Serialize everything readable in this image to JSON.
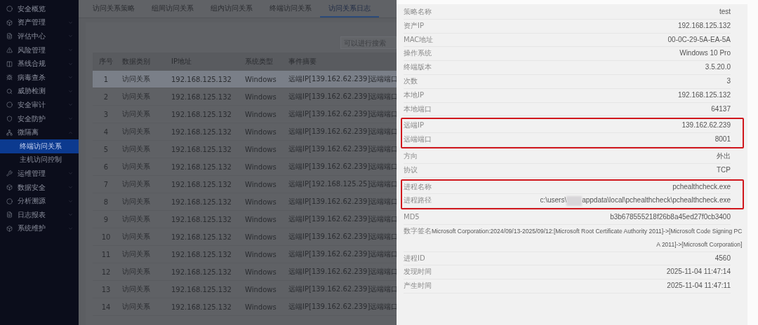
{
  "sidebar": {
    "items": [
      {
        "label": "安全概览",
        "selected": false
      },
      {
        "label": "资产管理",
        "selected": false
      },
      {
        "label": "评估中心",
        "selected": false
      },
      {
        "label": "风险管理",
        "selected": false
      },
      {
        "label": "基线合规",
        "selected": false
      },
      {
        "label": "病毒查杀",
        "selected": false
      },
      {
        "label": "威胁检测",
        "selected": false
      },
      {
        "label": "安全审计",
        "selected": false
      },
      {
        "label": "安全防护",
        "selected": false
      },
      {
        "label": "微隔离",
        "selected": false,
        "children": [
          {
            "label": "终端访问关系",
            "selected": true
          },
          {
            "label": "主机访问控制",
            "selected": false
          }
        ]
      },
      {
        "label": "运维管理",
        "selected": false
      },
      {
        "label": "数据安全",
        "selected": false
      },
      {
        "label": "分析溯源",
        "selected": false
      },
      {
        "label": "日志报表",
        "selected": false
      },
      {
        "label": "系统维护",
        "selected": false
      }
    ]
  },
  "tabs": [
    {
      "label": "访问关系策略",
      "selected": false
    },
    {
      "label": "组间访问关系",
      "selected": false
    },
    {
      "label": "组内访问关系",
      "selected": false
    },
    {
      "label": "终端访问关系",
      "selected": false
    },
    {
      "label": "访问关系日志",
      "selected": true
    }
  ],
  "search": {
    "placeholder": "可以进行搜索"
  },
  "table": {
    "columns": [
      "序号",
      "数据类别",
      "IP地址",
      "系统类型",
      "事件摘要"
    ],
    "rows": [
      {
        "cells": [
          "1",
          "访问关系",
          "192.168.125.132",
          "Windows",
          "远端IP[139.162.62.239]远端端口"
        ],
        "selected": true
      },
      {
        "cells": [
          "2",
          "访问关系",
          "192.168.125.132",
          "Windows",
          "远端IP[139.162.62.239]远端端口"
        ],
        "selected": false
      },
      {
        "cells": [
          "3",
          "访问关系",
          "192.168.125.132",
          "Windows",
          "远端IP[139.162.62.239]远端端口"
        ],
        "selected": false
      },
      {
        "cells": [
          "4",
          "访问关系",
          "192.168.125.132",
          "Windows",
          "远端IP[139.162.62.239]远端端口"
        ],
        "selected": false
      },
      {
        "cells": [
          "5",
          "访问关系",
          "192.168.125.132",
          "Windows",
          "远端IP[139.162.62.239]远端端口"
        ],
        "selected": false
      },
      {
        "cells": [
          "6",
          "访问关系",
          "192.168.125.132",
          "Windows",
          "远端IP[139.162.62.239]远端端口"
        ],
        "selected": false
      },
      {
        "cells": [
          "7",
          "访问关系",
          "192.168.125.132",
          "Windows",
          "远端IP[192.168.125.25]远端端口"
        ],
        "selected": false
      },
      {
        "cells": [
          "8",
          "访问关系",
          "192.168.125.132",
          "Windows",
          "远端IP[139.162.62.239]远端端口"
        ],
        "selected": false
      },
      {
        "cells": [
          "9",
          "访问关系",
          "192.168.125.132",
          "Windows",
          "远端IP[139.162.62.239]远端端口"
        ],
        "selected": false
      },
      {
        "cells": [
          "10",
          "访问关系",
          "192.168.125.132",
          "Windows",
          "远端IP[139.162.62.239]远端端口"
        ],
        "selected": false
      },
      {
        "cells": [
          "11",
          "访问关系",
          "192.168.125.132",
          "Windows",
          "远端IP[139.162.62.239]远端端口"
        ],
        "selected": false
      },
      {
        "cells": [
          "12",
          "访问关系",
          "192.168.125.132",
          "Windows",
          "远端IP[139.162.62.239]远端端口"
        ],
        "selected": false
      },
      {
        "cells": [
          "13",
          "访问关系",
          "192.168.125.132",
          "Windows",
          "远端IP[139.162.62.239]远端端口"
        ],
        "selected": false
      },
      {
        "cells": [
          "14",
          "访问关系",
          "192.168.125.132",
          "Windows",
          "远端IP[139.162.62.239]远端端口"
        ],
        "selected": false
      }
    ]
  },
  "details": {
    "groups": [
      {
        "highlighted": false,
        "fields": [
          {
            "label": "策略名称",
            "value": [
              "test"
            ]
          },
          {
            "label": "资产IP",
            "value": [
              "192.168.125.132"
            ]
          },
          {
            "label": "MAC地址",
            "value": [
              "00-0C-29-5A-EA-5A"
            ]
          },
          {
            "label": "操作系统",
            "value": [
              "Windows 10 Pro"
            ]
          },
          {
            "label": "终端版本",
            "value": [
              "3.5.20.0"
            ]
          },
          {
            "label": "次数",
            "value": [
              "3"
            ]
          },
          {
            "label": "本地IP",
            "value": [
              "192.168.125.132"
            ]
          },
          {
            "label": "本地端口",
            "value": [
              "64137"
            ]
          }
        ]
      },
      {
        "highlighted": true,
        "fields": [
          {
            "label": "远端IP",
            "value": [
              "139.162.62.239"
            ]
          },
          {
            "label": "远端端口",
            "value": [
              "8001"
            ]
          }
        ]
      },
      {
        "highlighted": false,
        "fields": [
          {
            "label": "方向",
            "value": [
              "外出"
            ]
          },
          {
            "label": "协议",
            "value": [
              "TCP"
            ]
          }
        ]
      },
      {
        "highlighted": true,
        "fields": [
          {
            "label": "进程名称",
            "value": [
              "pchealthcheck.exe"
            ]
          },
          {
            "label": "进程路径",
            "value": [
              "c:\\users\\",
              "appdata\\local\\pchealthcheck\\pchealthcheck.exe"
            ],
            "redacted": true
          }
        ]
      },
      {
        "highlighted": false,
        "fields": [
          {
            "label": "MD5",
            "value": [
              "b3b678555218f26b8a45ed27f0cb3400"
            ]
          },
          {
            "label": "数字签名",
            "value": [
              "Microsoft Corporation:2024/09/13-2025/09/12:[Microsoft Root Certificate Authority 2011]->[Microsoft Code Signing PC",
              "A 2011]->[Microsoft Corporation]"
            ]
          },
          {
            "label": "进程ID",
            "value": [
              "4560"
            ]
          },
          {
            "label": "发现时间",
            "value": [
              "2025-11-04 11:47:14"
            ]
          },
          {
            "label": "产生时间",
            "value": [
              "2025-11-04 11:47:11"
            ]
          }
        ]
      }
    ]
  }
}
